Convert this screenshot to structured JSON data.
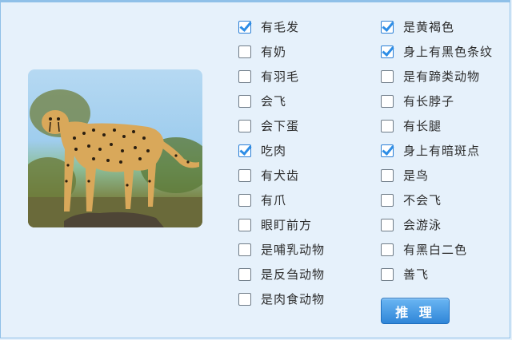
{
  "photo": {
    "subject": "cheetah"
  },
  "left_items": [
    {
      "label": "有毛发",
      "checked": true
    },
    {
      "label": "有奶",
      "checked": false
    },
    {
      "label": "有羽毛",
      "checked": false
    },
    {
      "label": "会飞",
      "checked": false
    },
    {
      "label": "会下蛋",
      "checked": false
    },
    {
      "label": "吃肉",
      "checked": true
    },
    {
      "label": "有犬齿",
      "checked": false
    },
    {
      "label": "有爪",
      "checked": false
    },
    {
      "label": "眼盯前方",
      "checked": false
    },
    {
      "label": "是哺乳动物",
      "checked": false
    },
    {
      "label": "是反刍动物",
      "checked": false
    },
    {
      "label": "是肉食动物",
      "checked": false
    }
  ],
  "right_items": [
    {
      "label": "是黄褐色",
      "checked": true
    },
    {
      "label": "身上有黑色条纹",
      "checked": true
    },
    {
      "label": "是有蹄类动物",
      "checked": false
    },
    {
      "label": "有长脖子",
      "checked": false
    },
    {
      "label": "有长腿",
      "checked": false
    },
    {
      "label": "身上有暗斑点",
      "checked": true
    },
    {
      "label": "是鸟",
      "checked": false
    },
    {
      "label": "不会飞",
      "checked": false
    },
    {
      "label": "会游泳",
      "checked": false
    },
    {
      "label": "有黑白二色",
      "checked": false
    },
    {
      "label": "善飞",
      "checked": false
    }
  ],
  "button": {
    "label": "推 理"
  },
  "colors": {
    "accent": "#2d8de6",
    "background": "#e6f1fb"
  }
}
